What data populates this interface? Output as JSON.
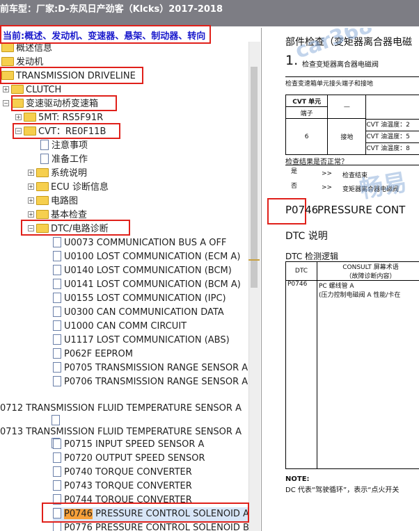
{
  "window": {
    "title": "前车型：厂家:D-东风日产劲客（Klcks）2017-2018"
  },
  "breadcrumb": {
    "text": "当前:概述、发动机、变速器、悬架、制动器、转向"
  },
  "tree": {
    "overview": "概述信息",
    "engine": "发动机",
    "transmission": "TRANSMISSION DRIVELINE",
    "clutch": "CLUTCH",
    "transaxle": "变速驱动桥变速箱",
    "mt": "5MT: RS5F91R",
    "cvt": "CVT：RE0F11B",
    "precautions": "注意事项",
    "preparation": "准备工作",
    "system_desc": "系统说明",
    "ecu_diag": "ECU 诊断信息",
    "wiring": "电路图",
    "basic_check": "基本检查",
    "dtc_circuit": "DTC/电路诊断",
    "dtc_items": [
      "U0073 COMMUNICATION BUS A OFF",
      "U0100 LOST COMMUNICATION (ECM A)",
      "U0140 LOST COMMUNICATION (BCM)",
      "U0141 LOST COMMUNICATION (BCM A)",
      "U0155 LOST COMMUNICATION (IPC)",
      "U0300 CAN COMMUNICATION DATA",
      "U1000 CAN COMM CIRCUIT",
      "U1117 LOST COMMUNICATION (ABS)",
      "P062F EEPROM",
      "P0705 TRANSMISSION RANGE SENSOR A",
      "P0706 TRANSMISSION RANGE SENSOR A"
    ],
    "p0712": "0712 TRANSMISSION FLUID TEMPERATURE SENSOR A",
    "p0713": "0713 TRANSMISSION FLUID TEMPERATURE SENSOR A",
    "dtc_items2": [
      "P0715 INPUT SPEED SENSOR A",
      "P0720 OUTPUT SPEED SENSOR",
      "P0740 TORQUE CONVERTER",
      "P0743 TORQUE CONVERTER",
      "P0744 TORQUE CONVERTER"
    ],
    "selected_code": "P0746",
    "selected_rest": " PRESSURE CONTROL SOLENOID A",
    "last_item": "P0776 PRESSURE CONTROL SOLENOID B"
  },
  "document": {
    "heading": "部件检查（变矩器离合器电磁",
    "step_num": "1.",
    "step_title": "检查变矩器离合器电磁阀",
    "step_instr": "检查变速箱单元接头端子和接地",
    "table_head_cvt": "CVT 单元",
    "table_head_dash": "—",
    "table_head_terminal": "端子",
    "table_terminal": "6",
    "table_ground": "接地",
    "table_temps": [
      "CVT 油温度：2",
      "CVT 油温度：5",
      "CVT 油温度：8"
    ],
    "result_q": "检查结果是否正常？",
    "yes": "是",
    "yes_arrow": ">>",
    "yes_action": "检查结束",
    "no": "否",
    "no_arrow": ">>",
    "no_action": "变矩器离合器电磁阀",
    "dtc_code": "P0746",
    "dtc_title_rest": " PRESSURE CONT",
    "dtc_desc": "DTC 说明",
    "dtc_logic": "DTC 检测逻辑",
    "logic_col1": "DTC",
    "logic_col2": "CONSULT 屏幕术语",
    "logic_col2b": "（故障诊断内容）",
    "logic_code": "P0746",
    "logic_term": "PC 螺线管 A",
    "logic_term2": "(压力控制电磁阀 A 性能/卡在",
    "note_label": "NOTE:",
    "note_text": "DC 代表“驾驶循环”，表示“点火开关"
  },
  "watermarks": [
    "car368",
    "畅易"
  ]
}
